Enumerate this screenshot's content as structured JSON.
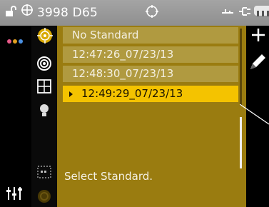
{
  "status_bar": {
    "text": "3998 D65",
    "icons": [
      "lock-open-icon",
      "crosshair-icon",
      "target-icon",
      "usb-icon",
      "plug-icon",
      "battery-icon"
    ]
  },
  "left_rail": {
    "dots_colors": [
      "#e85a8a",
      "#e0a020",
      "#4a90e2"
    ],
    "icons": [
      "dots-menu-icon",
      "tuning-sliders-icon"
    ]
  },
  "tool_column": {
    "icons": [
      "target-selected-icon",
      "concentric-circles-icon",
      "grid-icon",
      "lightbulb-icon",
      "dashed-box-icon",
      "disabled-target-icon"
    ]
  },
  "list": {
    "items": [
      {
        "label": "No Standard"
      },
      {
        "label": "12:47:26_07/23/13"
      },
      {
        "label": "12:48:30_07/23/13"
      },
      {
        "label": "12:49:29_07/23/13",
        "selected": true
      }
    ]
  },
  "prompt": "Select Standard.",
  "right_column": {
    "icons": [
      "plus-icon",
      "pen-icon"
    ]
  },
  "colors": {
    "accent_yellow": "#f4c300",
    "panel_gold": "#9a7c10",
    "row_gold": "#b09a40",
    "status_gray": "#9a9a9a"
  }
}
